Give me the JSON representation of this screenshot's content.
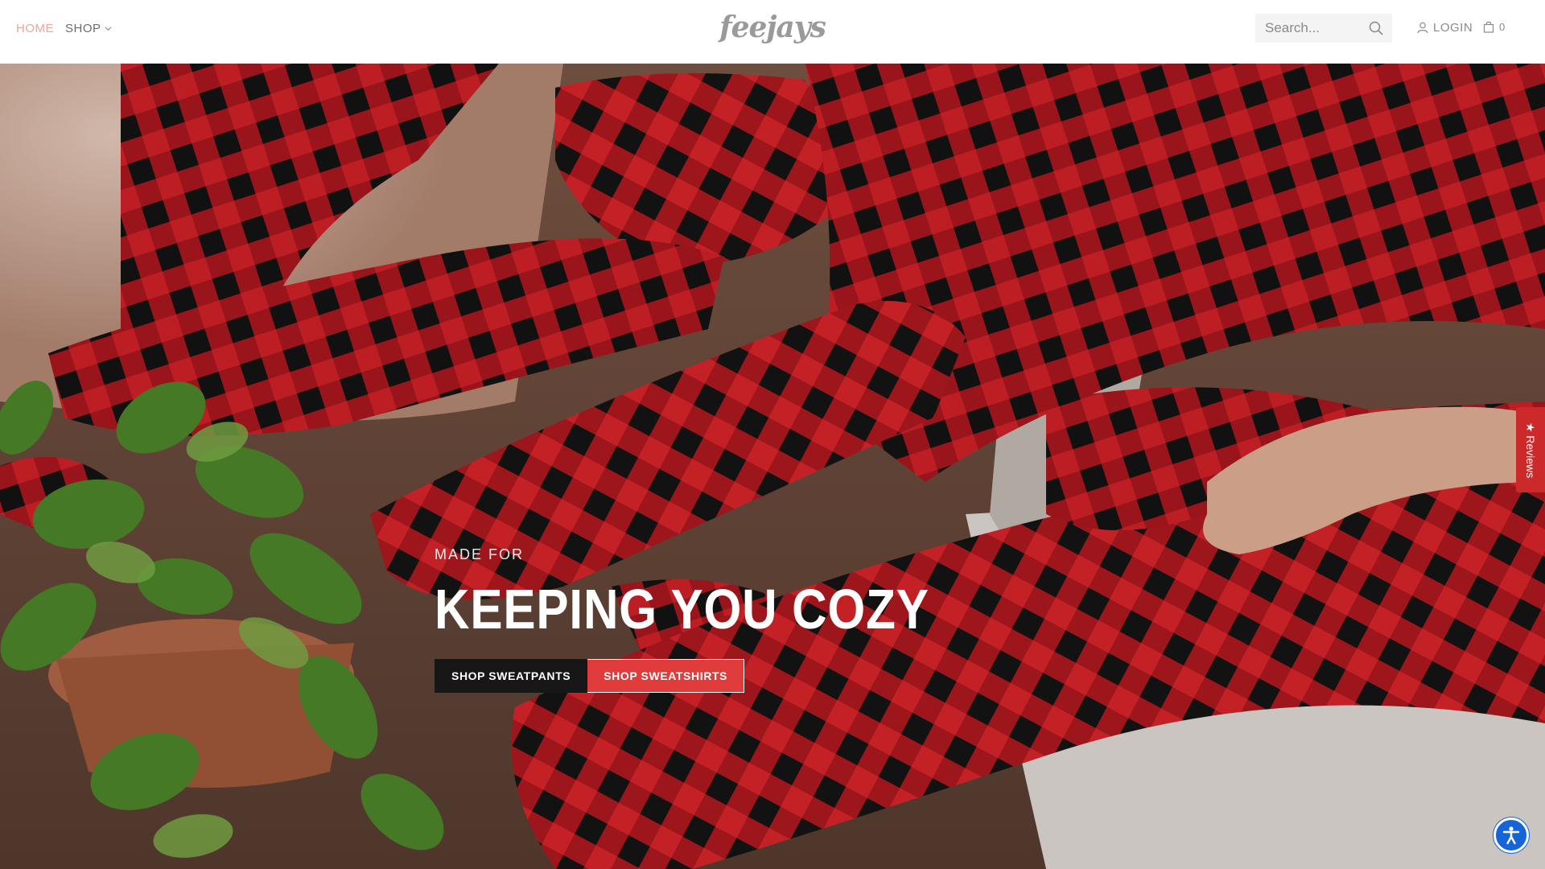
{
  "header": {
    "nav": [
      {
        "label": "HOME",
        "active": true
      },
      {
        "label": "SHOP",
        "active": false,
        "has_dropdown": true
      }
    ],
    "logo_text": "feejays",
    "search": {
      "placeholder": "Search...",
      "value": ""
    },
    "login_label": "LOGIN",
    "cart_count": "0"
  },
  "hero": {
    "kicker": "MADE FOR",
    "headline": "KEEPING YOU COZY",
    "buttons": [
      {
        "label": "SHOP SWEATPANTS",
        "style": "dark"
      },
      {
        "label": "SHOP SWEATSHIRTS",
        "style": "red"
      }
    ]
  },
  "widgets": {
    "reviews_label": "★ Reviews",
    "accessibility_icon": "accessibility-icon"
  },
  "colors": {
    "plaid_red": "#d8232a",
    "plaid_black": "#141414",
    "accent_red": "#e13c3c",
    "reviews_red": "#cc2a2a",
    "a11y_blue": "#1565d8",
    "home_active": "#e7a7a0"
  }
}
